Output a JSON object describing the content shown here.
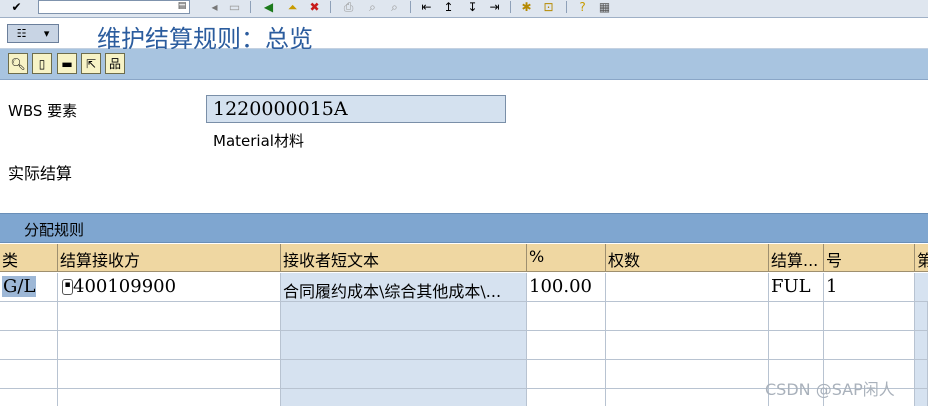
{
  "title": "维护结算规则：总览",
  "header": {
    "wbs_label": "WBS 要素",
    "wbs_value": "1220000015A",
    "wbs_desc": "Material材料",
    "actual_settlement_label": "实际结算"
  },
  "group_title": "分配规则",
  "table": {
    "headers": [
      "类",
      "结算接收方",
      "接收者短文本",
      "%",
      "权数",
      "结算...",
      "号",
      "第"
    ],
    "rows": [
      [
        "G/L",
        "400109900",
        "合同履约成本\\综合其他成本\\...",
        "100.00",
        "",
        "FUL",
        "1",
        ""
      ]
    ]
  },
  "watermark": "CSDN @SAP闲人",
  "colors": {
    "title": "#2b5c9e",
    "app_toolbar": "#a8c4e0",
    "group_title": "#7fa6d0",
    "column_header": "#efd7a2",
    "readonly_cell": "#d6e2f0"
  },
  "icons": {
    "system_toolbar": [
      "enter-check-icon",
      "back-arrow-icon",
      "save-icon",
      "back-icon",
      "exit-icon",
      "cancel-icon",
      "print-icon",
      "find-icon",
      "find-next-icon",
      "first-page-icon",
      "prev-page-icon",
      "next-page-icon",
      "last-page-icon",
      "new-session-icon",
      "shortcut-icon",
      "help-icon",
      "layout-icon"
    ],
    "app_toolbar": [
      "detail-icon",
      "new-entry-icon",
      "delete-icon",
      "previous-object-icon",
      "hierarchy-icon"
    ]
  }
}
